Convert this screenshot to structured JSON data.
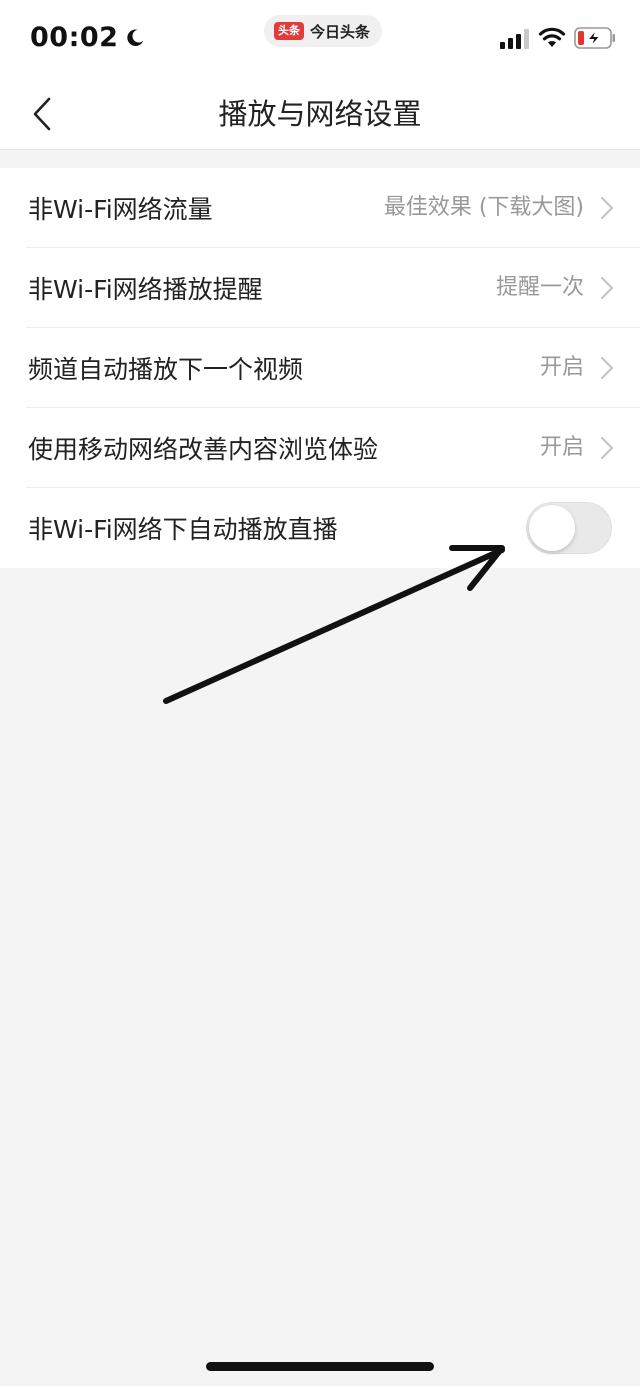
{
  "status_bar": {
    "time": "00:02",
    "app_logo_text": "头条",
    "app_name": "今日头条"
  },
  "nav": {
    "title": "播放与网络设置"
  },
  "settings": {
    "rows": [
      {
        "label": "非Wi-Fi网络流量",
        "value": "最佳效果 (下载大图)"
      },
      {
        "label": "非Wi-Fi网络播放提醒",
        "value": "提醒一次"
      },
      {
        "label": "频道自动播放下一个视频",
        "value": "开启"
      },
      {
        "label": "使用移动网络改善内容浏览体验",
        "value": "开启"
      }
    ],
    "toggle_row": {
      "label": "非Wi-Fi网络下自动播放直播",
      "enabled": false
    }
  },
  "colors": {
    "accent_logo": "#e23b3b",
    "value_text": "#999999",
    "background": "#f4f4f4"
  }
}
